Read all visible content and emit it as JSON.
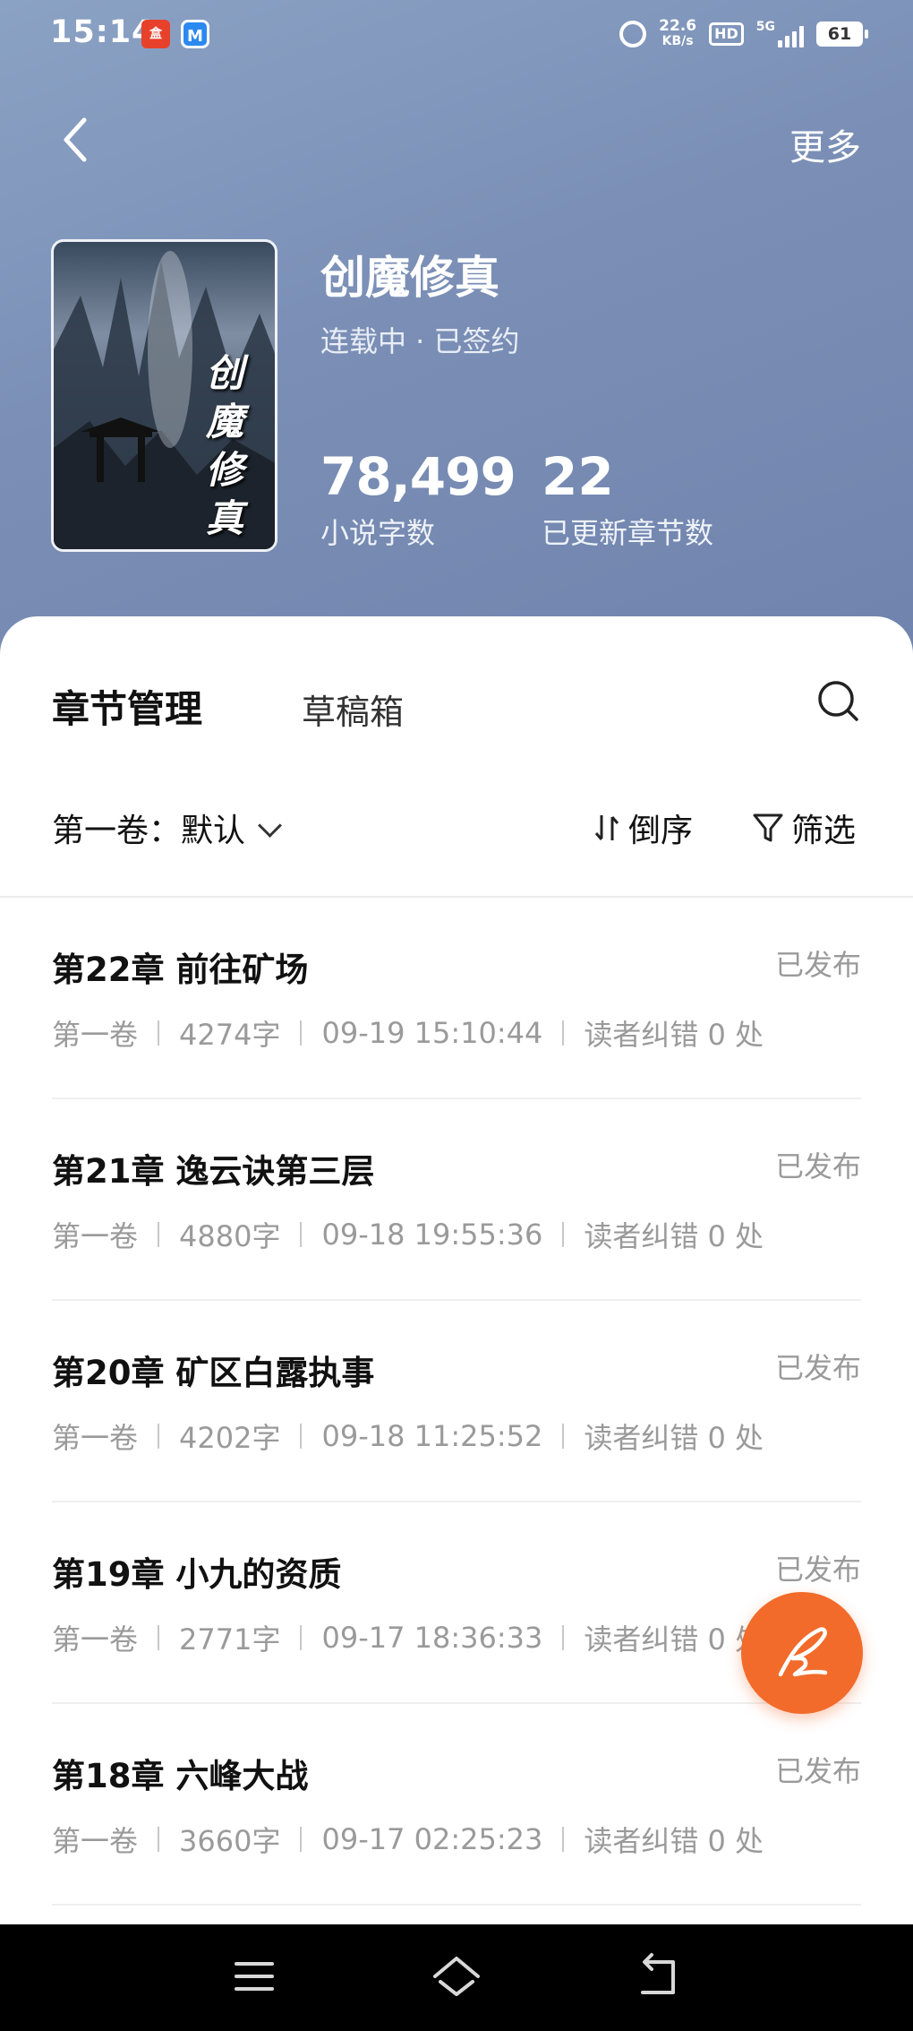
{
  "status_bar": {
    "time": "15:14",
    "app1_badge": "盒",
    "app2_badge": "M",
    "speed_value": "22.6",
    "speed_unit": "KB/s",
    "hd": "HD",
    "network": "5G",
    "battery": "61"
  },
  "nav": {
    "back_icon": "chevron-left-icon",
    "more_label": "更多"
  },
  "book": {
    "cover_title": "创魔修真",
    "title": "创魔修真",
    "status": "连载中 · 已签约",
    "word_count": "78,499",
    "word_count_label": "小说字数",
    "chapter_count": "22",
    "chapter_count_label": "已更新章节数"
  },
  "tabs": {
    "active": "章节管理",
    "draft": "草稿箱"
  },
  "toolbar": {
    "volume_label": "第一卷：默认",
    "sort_label": "倒序",
    "filter_label": "筛选"
  },
  "chapters": [
    {
      "title": "第22章 前往矿场",
      "status": "已发布",
      "volume": "第一卷",
      "words": "4274字",
      "time": "09-19 15:10:44",
      "errata": "读者纠错 0 处"
    },
    {
      "title": "第21章 逸云诀第三层",
      "status": "已发布",
      "volume": "第一卷",
      "words": "4880字",
      "time": "09-18 19:55:36",
      "errata": "读者纠错 0 处"
    },
    {
      "title": "第20章 矿区白露执事",
      "status": "已发布",
      "volume": "第一卷",
      "words": "4202字",
      "time": "09-18 11:25:52",
      "errata": "读者纠错 0 处"
    },
    {
      "title": "第19章 小九的资质",
      "status": "已发布",
      "volume": "第一卷",
      "words": "2771字",
      "time": "09-17 18:36:33",
      "errata": "读者纠错 0 处"
    },
    {
      "title": "第18章 六峰大战",
      "status": "已发布",
      "volume": "第一卷",
      "words": "3660字",
      "time": "09-17 02:25:23",
      "errata": "读者纠错 0 处"
    }
  ],
  "colors": {
    "header_gradient_start": "#8aa2c4",
    "header_gradient_end": "#6f83ad",
    "fab": "#f26b2a",
    "muted_text": "#9a9a9a"
  }
}
